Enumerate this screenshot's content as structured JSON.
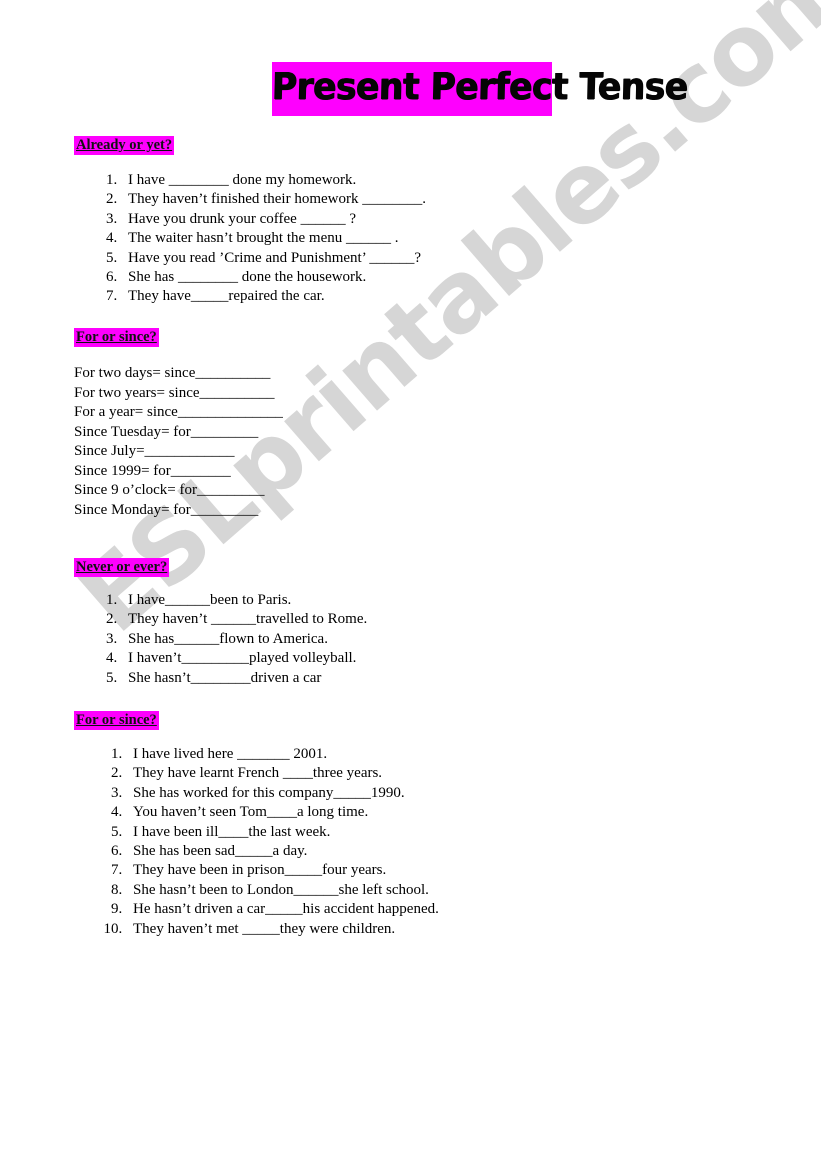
{
  "watermark": {
    "text": "ESLprintables.com",
    "color": "#d6d6d6"
  },
  "title": {
    "text": "Present Perfect Tense",
    "highlight_color": "#fe00fe",
    "text_color": "#050505"
  },
  "sections": [
    {
      "id": "already-or-yet",
      "header": "Already or yet?",
      "type": "numbered-list",
      "items": [
        "I have ________ done my homework.",
        "They haven’t finished their homework ________.",
        "Have you drunk your coffee ______ ?",
        "The waiter hasn’t brought the menu ______ .",
        "Have you read ’Crime and Punishment’ ______?",
        "She has ________ done the housework.",
        "They have_____repaired the car."
      ]
    },
    {
      "id": "for-or-since-1",
      "header": "For or since?",
      "type": "equation-block",
      "lines": [
        "For two days= since__________",
        "For two years= since__________",
        "For a year= since______________",
        "Since Tuesday= for_________",
        "Since July=____________",
        "Since 1999= for________",
        "Since 9 o’clock= for_________",
        "Since Monday= for_________"
      ]
    },
    {
      "id": "never-or-ever",
      "header": "Never or  ever?",
      "type": "numbered-list",
      "items": [
        "I have______been to Paris.",
        "They haven’t ______travelled to Rome.",
        "She has______flown to America.",
        "I haven’t_________played volleyball.",
        "She hasn’t________driven a car"
      ]
    },
    {
      "id": "for-or-since-2",
      "header": "For or since?",
      "type": "numbered-list",
      "items": [
        "I have lived here _______ 2001.",
        "They have learnt French ____three years.",
        "She has worked for this company_____1990.",
        "You haven’t seen Tom____a long time.",
        "I have been ill____the last week.",
        "She has been sad_____a day.",
        "They have been in prison_____four years.",
        "She hasn’t been to London______she left school.",
        "He hasn’t driven a car_____his accident happened.",
        "They haven’t met _____they were children."
      ]
    }
  ]
}
